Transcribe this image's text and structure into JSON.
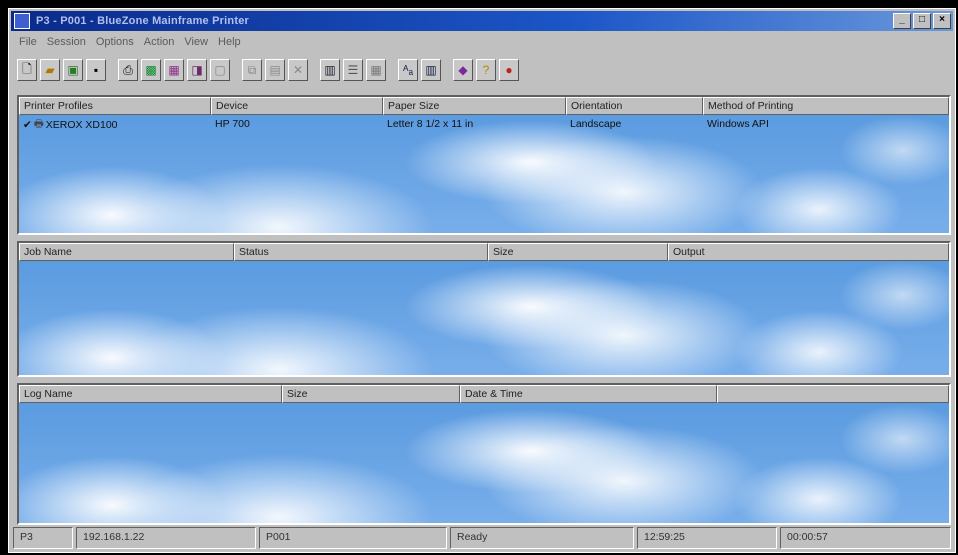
{
  "window": {
    "title": "P3 - P001 - BlueZone Mainframe Printer"
  },
  "menu": [
    "File",
    "Session",
    "Options",
    "Action",
    "View",
    "Help"
  ],
  "toolbar": {
    "buttons": [
      "new-icon",
      "open-icon",
      "folder-icon",
      "save-icon",
      "print-icon",
      "monitor-icon",
      "settings-icon",
      "screen-icon",
      "blank-icon",
      "copy-icon",
      "paste-icon",
      "delete-icon",
      "printer-props-icon",
      "list-icon",
      "grid-icon",
      "font-icon",
      "view-icon",
      "book-icon",
      "help-icon",
      "apple-icon"
    ]
  },
  "profiles_pane": {
    "columns": [
      "Printer Profiles",
      "Device",
      "Paper Size",
      "Orientation",
      "Method of Printing"
    ],
    "rows": [
      {
        "profile": "XEROX XD100",
        "device": "HP 700",
        "paper": "Letter 8 1/2 x 11 in",
        "orientation": "Landscape",
        "method": "Windows API"
      }
    ]
  },
  "jobs_pane": {
    "columns": [
      "Job Name",
      "Status",
      "Size",
      "Output"
    ]
  },
  "log_pane": {
    "columns": [
      "Log Name",
      "Size",
      "Date & Time",
      ""
    ]
  },
  "statusbar": {
    "session": "P3",
    "ip": "192.168.1.22",
    "device": "P001",
    "state": "Ready",
    "time": "12:59:25",
    "elapsed": "00:00:57"
  },
  "colors": {
    "sky": "#5b9be0",
    "titlebar": "#0a2a8a",
    "face": "#c0c0c0"
  }
}
